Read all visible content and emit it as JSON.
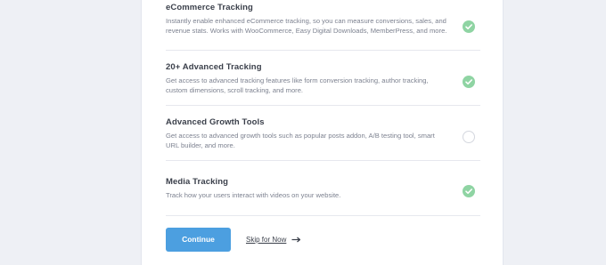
{
  "features": [
    {
      "title": "eCommerce Tracking",
      "description": "Instantly enable enhanced eCommerce tracking, so you can measure conversions, sales, and revenue stats. Works with WooCommerce, Easy Digital Downloads, MemberPress, and more.",
      "checked": true
    },
    {
      "title": "20+ Advanced Tracking",
      "description": "Get access to advanced tracking features like form conversion tracking, author tracking, custom dimensions, scroll tracking, and more.",
      "checked": true
    },
    {
      "title": "Advanced Growth Tools",
      "description": "Get access to advanced growth tools such as popular posts addon, A/B testing tool, smart URL builder, and more.",
      "checked": false
    },
    {
      "title": "Media Tracking",
      "description": "Track how your users interact with videos on your website.",
      "checked": true
    }
  ],
  "actions": {
    "continue_label": "Continue",
    "skip_label": "Skip for Now"
  },
  "colors": {
    "background": "#eef0f5",
    "card": "#ffffff",
    "primary_button": "#4c9fe0",
    "check_active": "#8fd4a3",
    "check_inactive_border": "#d4d7de",
    "title_text": "#3a3f4a",
    "description_text": "#7d8290"
  },
  "icons": {
    "check": "checkmark-circle-icon",
    "skip_arrow": "arrow-right-icon"
  }
}
